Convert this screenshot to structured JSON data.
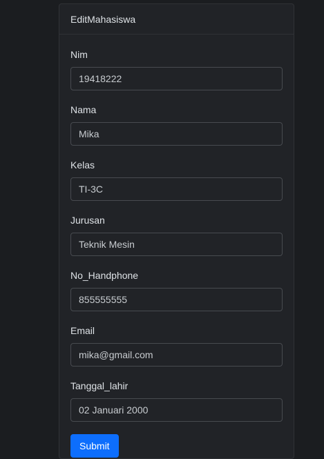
{
  "card": {
    "title": "EditMahasiswa"
  },
  "form": {
    "fields": [
      {
        "label": "Nim",
        "value": "19418222"
      },
      {
        "label": "Nama",
        "value": "Mika"
      },
      {
        "label": "Kelas",
        "value": "TI-3C"
      },
      {
        "label": "Jurusan",
        "value": "Teknik Mesin"
      },
      {
        "label": "No_Handphone",
        "value": "855555555"
      },
      {
        "label": "Email",
        "value": "mika@gmail.com"
      },
      {
        "label": "Tanggal_lahir",
        "value": "02 Januari 2000"
      }
    ],
    "submit_label": "Submit"
  },
  "colors": {
    "background": "#1b1d20",
    "card": "#212327",
    "accent": "#0d6efd"
  }
}
